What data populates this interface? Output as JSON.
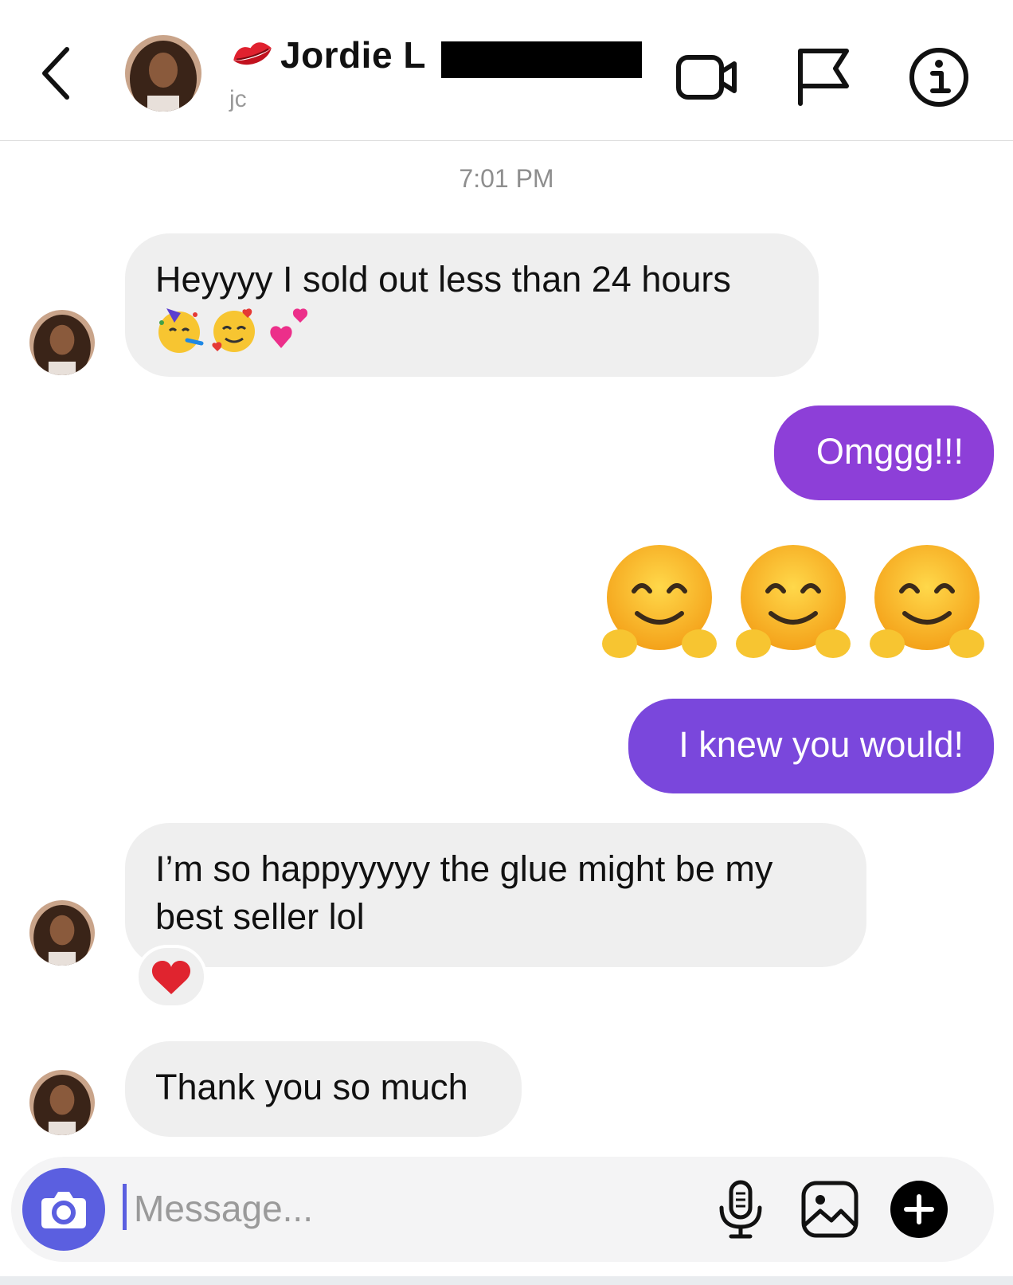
{
  "header": {
    "contact_name": "Jordie L",
    "handle": "jc",
    "lips_icon": "kiss-lips-emoji",
    "icons": [
      "back-chevron-icon",
      "video-camera-icon",
      "flag-icon",
      "info-icon"
    ]
  },
  "thread": {
    "timestamp": "7:01 PM",
    "messages": [
      {
        "direction": "in",
        "text": "Heyyyy I sold out less than 24 hours",
        "emojis": [
          "partying-face",
          "smiling-face-with-hearts",
          "revolving-hearts"
        ]
      },
      {
        "direction": "out",
        "text": "Omggg!!!"
      },
      {
        "direction": "out",
        "emojis": [
          "hugging-face",
          "hugging-face",
          "hugging-face"
        ]
      },
      {
        "direction": "out",
        "text": "I knew you would!"
      },
      {
        "direction": "in",
        "text": "I’m so happyyyyy the glue might be my best seller lol",
        "reaction": "red-heart"
      },
      {
        "direction": "in",
        "text": "Thank you so much"
      }
    ],
    "colors": {
      "outgoing_1": "#8d3fd8",
      "outgoing_2": "#7a47dc",
      "incoming": "#efefef"
    }
  },
  "composer": {
    "placeholder": "Message...",
    "value": "",
    "icons": [
      "camera-icon",
      "microphone-icon",
      "gallery-icon",
      "plus-icon"
    ],
    "accent": "#5b5fe0"
  }
}
